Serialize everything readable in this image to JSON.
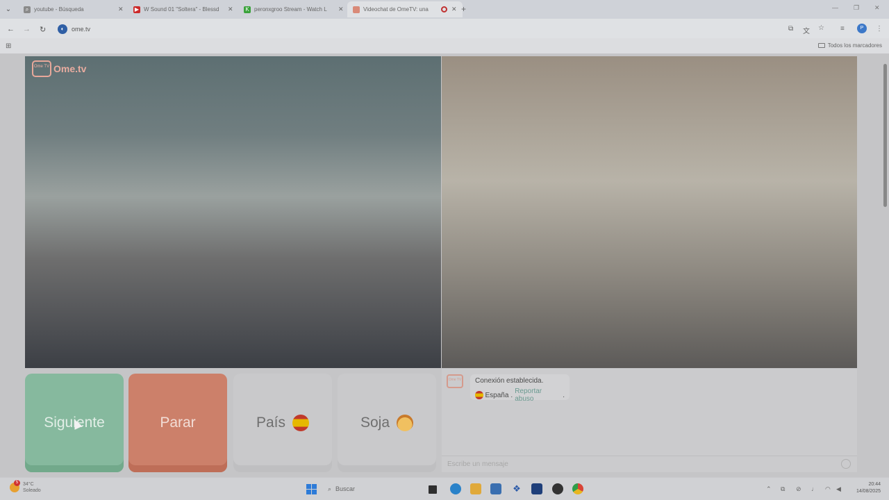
{
  "browser": {
    "tabs": [
      {
        "label": "youtube - Búsqueda",
        "favicon": "google-search-icon",
        "color": "#8a8a8a"
      },
      {
        "label": "W Sound 01 \"Soltera\" - Blessd",
        "favicon": "youtube-icon",
        "color": "#cc2a2a"
      },
      {
        "label": "peronxgroo Stream - Watch L",
        "favicon": "kick-icon",
        "color": "#3aa23a"
      },
      {
        "label": "Videochat de OmeTV: una",
        "favicon": "ometv-icon",
        "color": "#d98a78",
        "active": true
      }
    ],
    "new_tab": "+",
    "url": "ome.tv",
    "all_bookmarks": "Todos los marcadores",
    "profile_initial": "P"
  },
  "ometv": {
    "logo_badge": "Ome TV",
    "logo_text": "Ome.tv",
    "buttons": {
      "next": "Siguiente",
      "stop": "Parar",
      "country": "País",
      "gender": "Soja"
    },
    "chat": {
      "logo_badge": "Ome TV",
      "connection": "Conexión establecida.",
      "country": "España",
      "separator": ".",
      "report": "Reportar abuso",
      "report_end": ".",
      "input_placeholder": "Escribe un mensaje"
    },
    "colors": {
      "next": "#86b99e",
      "stop": "#cc806a",
      "neutral": "#c9c9cb"
    }
  },
  "taskbar": {
    "weather_badge": "5",
    "temperature": "34°C",
    "condition": "Soleado",
    "search_placeholder": "Buscar",
    "time": "20:44",
    "date": "14/08/2025"
  }
}
